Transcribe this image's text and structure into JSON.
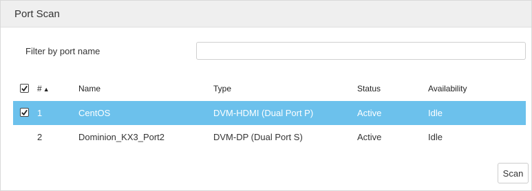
{
  "panel": {
    "title": "Port Scan"
  },
  "filter": {
    "label": "Filter by port name",
    "value": "",
    "placeholder": ""
  },
  "table": {
    "columns": {
      "num": "#",
      "num_sort_indicator": "▲",
      "name": "Name",
      "type": "Type",
      "status": "Status",
      "availability": "Availability"
    },
    "rows": [
      {
        "num": "1",
        "name": "CentOS",
        "type": "DVM-HDMI (Dual Port P)",
        "status": "Active",
        "availability": "Idle",
        "checked": true,
        "selected": true
      },
      {
        "num": "2",
        "name": "Dominion_KX3_Port2",
        "type": "DVM-DP (Dual Port S)",
        "status": "Active",
        "availability": "Idle",
        "checked": false,
        "selected": false
      }
    ]
  },
  "actions": {
    "scan_label": "Scan"
  },
  "colors": {
    "selected_row": "#6cc1ec",
    "header_bg": "#efefef"
  }
}
